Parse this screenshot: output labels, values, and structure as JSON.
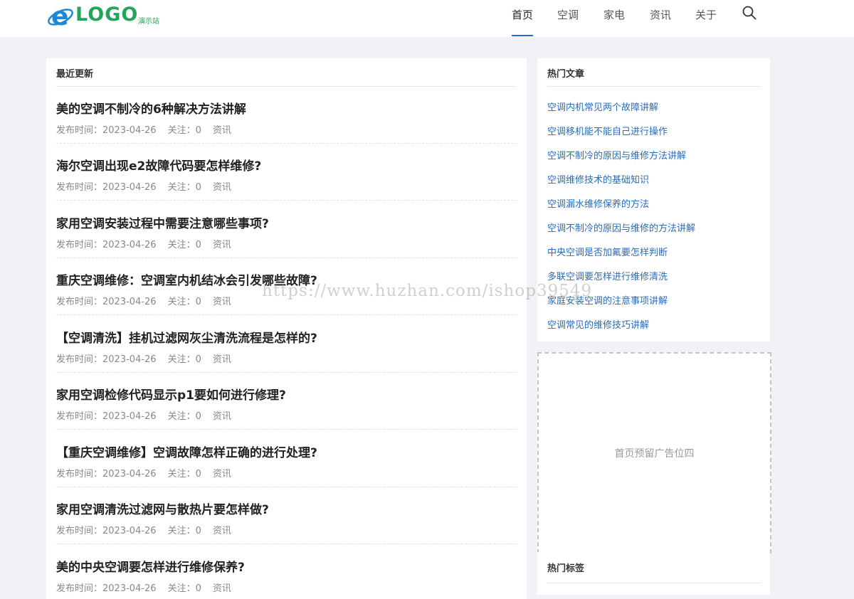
{
  "header": {
    "logo_text": "LOGO",
    "logo_sub": "演示站",
    "nav": [
      {
        "label": "首页",
        "active": true
      },
      {
        "label": "空调",
        "active": false
      },
      {
        "label": "家电",
        "active": false
      },
      {
        "label": "资讯",
        "active": false
      },
      {
        "label": "关于",
        "active": false
      }
    ]
  },
  "main": {
    "section_title": "最近更新",
    "articles": [
      {
        "title": "美的空调不制冷的6种解决方法讲解",
        "date_label": "发布时间：2023-04-26",
        "views_label": "关注：0",
        "category": "资讯"
      },
      {
        "title": "海尔空调出现e2故障代码要怎样维修?",
        "date_label": "发布时间：2023-04-26",
        "views_label": "关注：0",
        "category": "资讯"
      },
      {
        "title": "家用空调安装过程中需要注意哪些事项?",
        "date_label": "发布时间：2023-04-26",
        "views_label": "关注：0",
        "category": "资讯"
      },
      {
        "title": "重庆空调维修：空调室内机结冰会引发哪些故障?",
        "date_label": "发布时间：2023-04-26",
        "views_label": "关注：0",
        "category": "资讯"
      },
      {
        "title": "【空调清洗】挂机过滤网灰尘清洗流程是怎样的?",
        "date_label": "发布时间：2023-04-26",
        "views_label": "关注：0",
        "category": "资讯"
      },
      {
        "title": "家用空调检修代码显示p1要如何进行修理?",
        "date_label": "发布时间：2023-04-26",
        "views_label": "关注：0",
        "category": "资讯"
      },
      {
        "title": "【重庆空调维修】空调故障怎样正确的进行处理?",
        "date_label": "发布时间：2023-04-26",
        "views_label": "关注：0",
        "category": "资讯"
      },
      {
        "title": "家用空调清洗过滤网与散热片要怎样做?",
        "date_label": "发布时间：2023-04-26",
        "views_label": "关注：0",
        "category": "资讯"
      },
      {
        "title": "美的中央空调要怎样进行维修保养?",
        "date_label": "发布时间：2023-04-26",
        "views_label": "关注：0",
        "category": "资讯"
      }
    ]
  },
  "sidebar": {
    "hot_title": "热门文章",
    "hot_articles": [
      "空调内机常见两个故障讲解",
      "空调移机能不能自己进行操作",
      "空调不制冷的原因与维修方法讲解",
      "空调维修技术的基础知识",
      "空调漏水维修保养的方法",
      "空调不制冷的原因与维修的方法讲解",
      "中央空调是否加氟要怎样判断",
      "多联空调要怎样进行维修清洗",
      "家庭安装空调的注意事项讲解",
      "空调常见的维修技巧讲解"
    ],
    "ad_text": "首页预留广告位四",
    "tags_title": "热门标签"
  },
  "watermark": "https://www.huzhan.com/ishop39549",
  "colors": {
    "accent": "#1a73c2",
    "link": "#2a6cb8",
    "logo_green": "#22a55a",
    "logo_blue": "#1e88d6"
  }
}
